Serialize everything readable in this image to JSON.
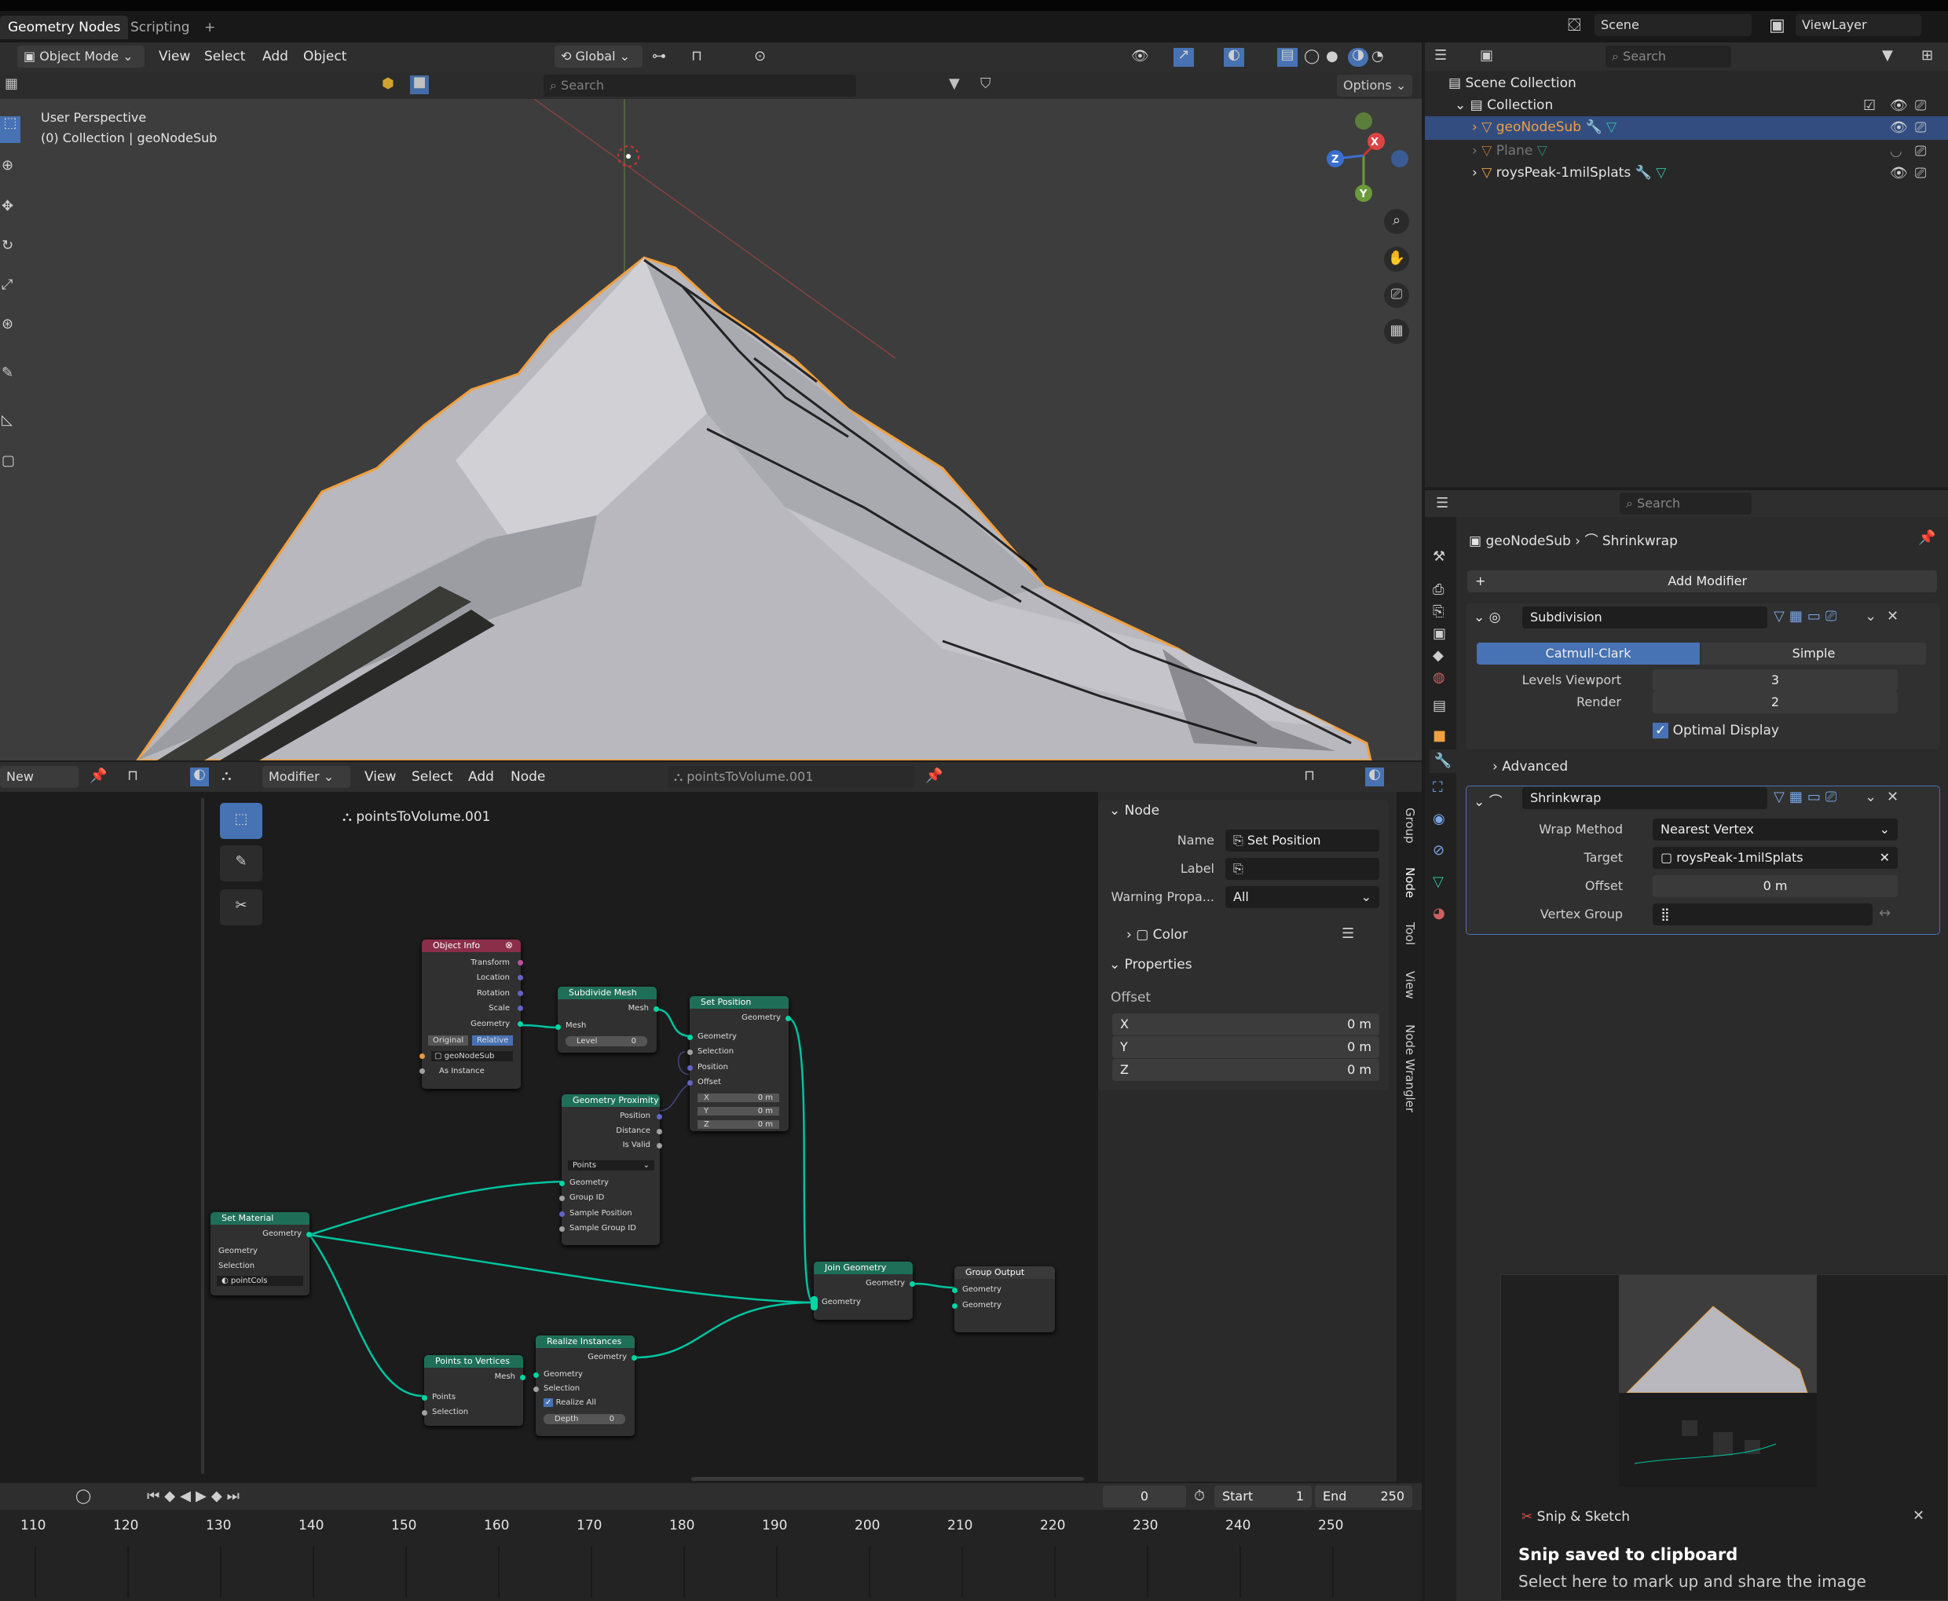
{
  "workspace": {
    "tabs": [
      "Geometry Nodes",
      "Scripting"
    ],
    "add": "+",
    "scene": "Scene",
    "view_layer": "ViewLayer"
  },
  "viewport": {
    "mode": "Object Mode",
    "menus": [
      "View",
      "Select",
      "Add",
      "Object"
    ],
    "orientation": "Global",
    "search_placeholder": "Search",
    "options": "Options",
    "overlay_title": "User Perspective",
    "overlay_sub": "(0) Collection | geoNodeSub",
    "gizmo": {
      "x": "X",
      "y": "Y",
      "z": "Z"
    }
  },
  "outliner": {
    "search_placeholder": "Search",
    "scene_collection": "Scene Collection",
    "collection": "Collection",
    "items": [
      {
        "name": "geoNodeSub",
        "selected": true
      },
      {
        "name": "Plane",
        "dim": true
      },
      {
        "name": "roysPeak-1milSplats"
      }
    ]
  },
  "properties": {
    "search_placeholder": "Search",
    "breadcrumb_object": "geoNodeSub",
    "breadcrumb_modifier": "Shrinkwrap",
    "add_modifier": "Add Modifier",
    "subdivision": {
      "name": "Subdivision",
      "tab_a": "Catmull-Clark",
      "tab_b": "Simple",
      "levels_label": "Levels Viewport",
      "levels_value": "3",
      "render_label": "Render",
      "render_value": "2",
      "optimal": "Optimal Display",
      "advanced": "Advanced"
    },
    "shrinkwrap": {
      "name": "Shrinkwrap",
      "wrap_label": "Wrap Method",
      "wrap_value": "Nearest Vertex",
      "target_label": "Target",
      "target_value": "roysPeak-1milSplats",
      "offset_label": "Offset",
      "offset_value": "0 m",
      "vgroup_label": "Vertex Group"
    }
  },
  "node_editor": {
    "new": "New",
    "editor_type": "Modifier",
    "menus": [
      "View",
      "Select",
      "Add",
      "Node"
    ],
    "tree_name": "pointsToVolume.001",
    "breadcrumb": "pointsToVolume.001",
    "vtabs": [
      "Group",
      "Node",
      "Tool",
      "View",
      "Node Wrangler"
    ],
    "nodes": {
      "object_info": {
        "title": "Object Info",
        "outputs": [
          "Transform",
          "Location",
          "Rotation",
          "Scale",
          "Geometry"
        ],
        "original": "Original",
        "relative": "Relative",
        "object": "geoNodeSub",
        "as_instance": "As Instance"
      },
      "subdivide": {
        "title": "Subdivide Mesh",
        "out": "Mesh",
        "in": "Mesh",
        "level": "Level",
        "level_val": "0"
      },
      "set_position": {
        "title": "Set Position",
        "out": "Geometry",
        "ins": [
          "Geometry",
          "Selection",
          "Position",
          "Offset"
        ],
        "x": "X",
        "y": "Y",
        "z": "Z",
        "val": "0 m"
      },
      "proximity": {
        "title": "Geometry Proximity",
        "outs": [
          "Position",
          "Distance",
          "Is Valid"
        ],
        "mode": "Points",
        "ins": [
          "Geometry",
          "Group ID",
          "Sample Position",
          "Sample Group ID"
        ]
      },
      "set_material": {
        "title": "Set Material",
        "out": "Geometry",
        "ins": [
          "Geometry",
          "Selection"
        ],
        "material": "pointCols"
      },
      "join": {
        "title": "Join Geometry",
        "out": "Geometry",
        "in": "Geometry"
      },
      "output": {
        "title": "Group Output",
        "ins": [
          "Geometry",
          "Geometry"
        ]
      },
      "p2v": {
        "title": "Points to Vertices",
        "out": "Mesh",
        "ins": [
          "Points",
          "Selection"
        ]
      },
      "realize": {
        "title": "Realize Instances",
        "out": "Geometry",
        "ins": [
          "Geometry",
          "Selection"
        ],
        "realize_all": "Realize All",
        "depth": "Depth",
        "depth_val": "0"
      }
    }
  },
  "sidebar": {
    "node_header": "Node",
    "name_label": "Name",
    "name_value": "Set Position",
    "label_label": "Label",
    "warning_label": "Warning Propa...",
    "warning_value": "All",
    "color": "Color",
    "props_header": "Properties",
    "offset": "Offset",
    "x": "X",
    "y": "Y",
    "z": "Z",
    "xval": "0 m",
    "yval": "0 m",
    "zval": "0 m"
  },
  "timeline": {
    "current": "0",
    "start_label": "Start",
    "start": "1",
    "end_label": "End",
    "end": "250",
    "ticks": [
      "110",
      "120",
      "130",
      "140",
      "150",
      "160",
      "170",
      "180",
      "190",
      "200",
      "210",
      "220",
      "230",
      "240",
      "250"
    ]
  },
  "toast": {
    "app": "Snip & Sketch",
    "title": "Snip saved to clipboard",
    "body": "Select here to mark up and share the image"
  }
}
